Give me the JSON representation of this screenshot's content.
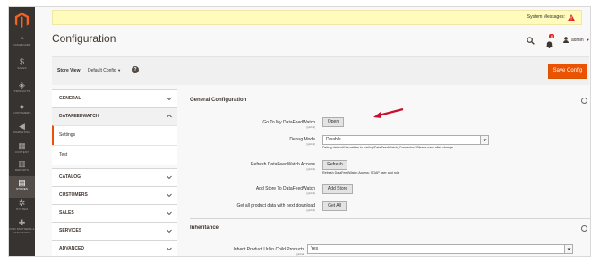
{
  "nav": {
    "items": [
      {
        "label": "DASHBOARD",
        "icon": "speedometer-icon"
      },
      {
        "label": "SALES",
        "icon": "dollar-icon"
      },
      {
        "label": "PRODUCTS",
        "icon": "cube-icon"
      },
      {
        "label": "CUSTOMERS",
        "icon": "user-icon"
      },
      {
        "label": "MARKETING",
        "icon": "megaphone-icon"
      },
      {
        "label": "CONTENT",
        "icon": "layout-icon"
      },
      {
        "label": "REPORTS",
        "icon": "bar-chart-icon"
      },
      {
        "label": "STORES",
        "icon": "storefront-icon"
      },
      {
        "label": "SYSTEM",
        "icon": "gear-icon"
      },
      {
        "label": "FIND PARTNERS & EXTENSIONS",
        "icon": "puzzle-icon"
      }
    ],
    "active_index": 7
  },
  "system_messages": {
    "label": "System Messages:",
    "count": "1"
  },
  "header": {
    "title": "Configuration",
    "notification_count": "6",
    "user": "admin"
  },
  "store_view": {
    "label": "Store View:",
    "value": "Default Config"
  },
  "save_button": "Save Config",
  "tabs": [
    {
      "label": "GENERAL",
      "open": false
    },
    {
      "label": "DATAFEEDWATCH",
      "open": true,
      "items": [
        "Settings",
        "Test"
      ]
    },
    {
      "label": "CATALOG",
      "open": false
    },
    {
      "label": "CUSTOMERS",
      "open": false
    },
    {
      "label": "SALES",
      "open": false
    },
    {
      "label": "SERVICES",
      "open": false
    },
    {
      "label": "ADVANCED",
      "open": false
    }
  ],
  "general": {
    "title": "General Configuration",
    "rows": [
      {
        "label": "Go To My DataFeedWatch",
        "scope": "[global]",
        "button": "Open"
      },
      {
        "label": "Debug Mode",
        "scope": "[global]",
        "select": "Disable",
        "note": "Debug data will be written to var/log/DataFeedWatch_Connector/. Please save after change"
      },
      {
        "label": "Refresh DataFeedWatch Access",
        "scope": "[global]",
        "button": "Refresh",
        "note": "Refresh DataFeedWatch Access: SOAP user and role"
      },
      {
        "label": "Add Store To DataFeedWatch",
        "scope": "[global]",
        "button": "Add Store"
      },
      {
        "label": "Get all product data with next download",
        "scope": "[global]",
        "button": "Get All"
      }
    ]
  },
  "inheritance": {
    "title": "Inheritance",
    "row": {
      "label": "Inherit Product Url in Child Products",
      "scope": "[global]",
      "select": "Yes"
    }
  },
  "colors": {
    "accent": "#eb5202",
    "nav_bg": "#373330",
    "message_bg": "#fffbbb",
    "arrow": "#c8102e"
  }
}
